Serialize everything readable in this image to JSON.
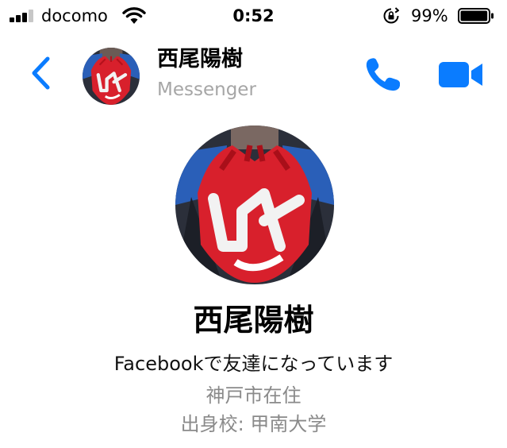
{
  "status_bar": {
    "carrier": "docomo",
    "time": "0:52",
    "battery_percent": "99%",
    "battery_level": 0.99,
    "signal_bars": 3,
    "signal_bars_total": 4
  },
  "header": {
    "contact_name": "西尾陽樹",
    "subtitle": "Messenger",
    "back_icon": "chevron-left-icon",
    "call_icon": "phone-icon",
    "video_icon": "video-camera-icon"
  },
  "profile": {
    "name": "西尾陽樹",
    "friend_status": "Facebookで友達になっています",
    "location": "神戸市在住",
    "school": "出身校: 甲南大学",
    "photo_mark": "UK"
  },
  "colors": {
    "accent": "#0a7cff",
    "secondary_text": "#8a8a8a",
    "glove_red": "#d8202c"
  }
}
